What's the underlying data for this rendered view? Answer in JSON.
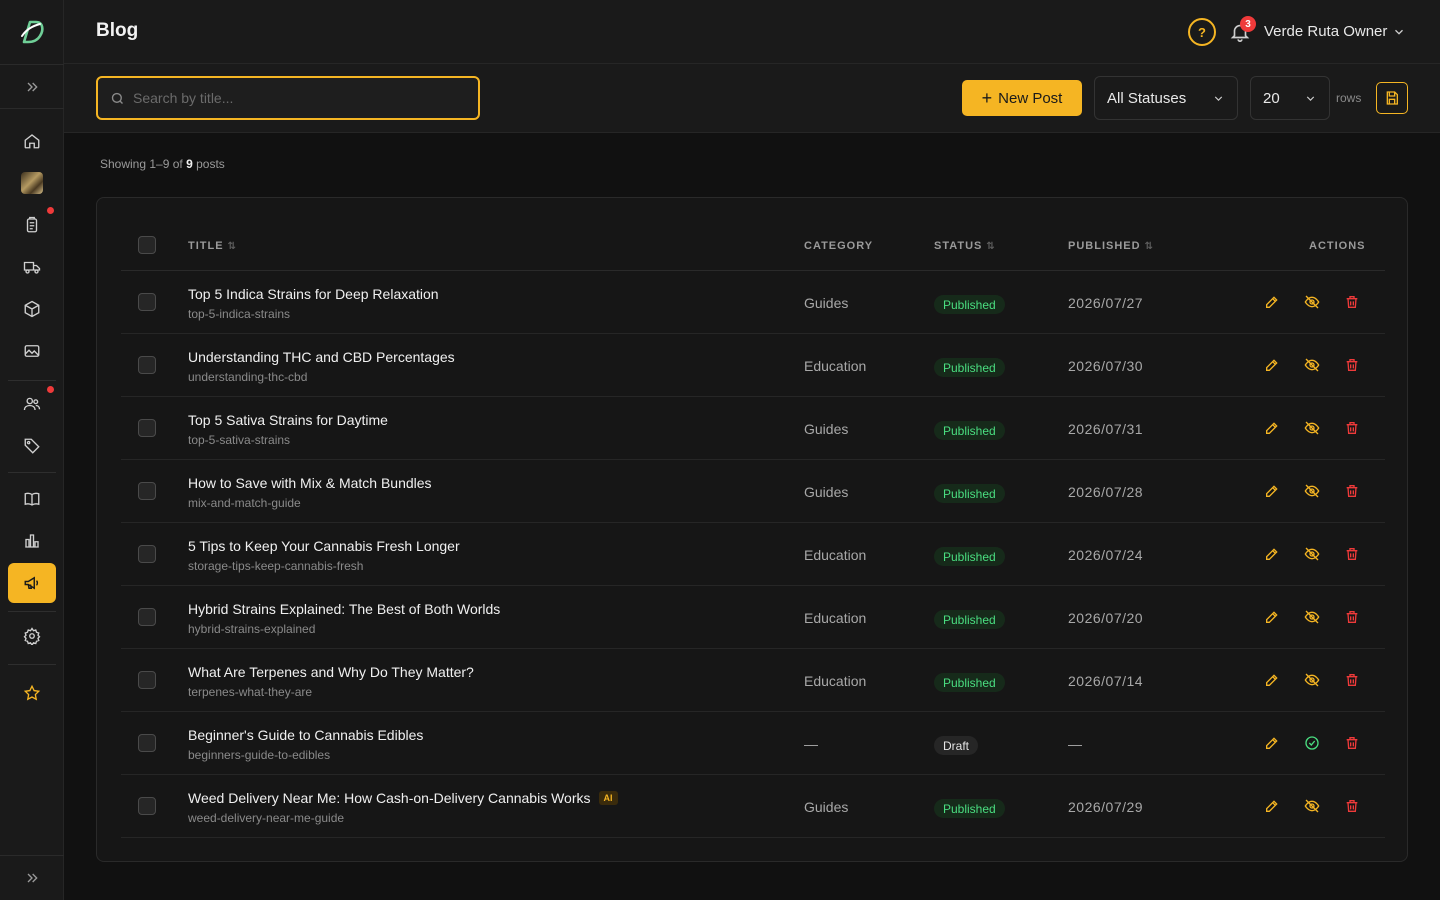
{
  "header": {
    "title": "Blog",
    "help": "?",
    "notifications": "3",
    "user": "Verde Ruta Owner"
  },
  "toolbar": {
    "search_placeholder": "Search by title...",
    "new_post": "New Post",
    "status_filter": "All Statuses",
    "page_size": "20",
    "rows_label": "rows"
  },
  "summary": {
    "prefix": "Showing 1–9 of",
    "count": "9",
    "suffix": "posts"
  },
  "table": {
    "headers": {
      "title": "TITLE",
      "category": "CATEGORY",
      "status": "STATUS",
      "published": "PUBLISHED",
      "actions": "ACTIONS"
    },
    "rows": [
      {
        "title": "Top 5 Indica Strains for Deep Relaxation",
        "slug": "top-5-indica-strains",
        "category": "Guides",
        "status": "Published",
        "date": "2026/07/27"
      },
      {
        "title": "Understanding THC and CBD Percentages",
        "slug": "understanding-thc-cbd",
        "category": "Education",
        "status": "Published",
        "date": "2026/07/30"
      },
      {
        "title": "Top 5 Sativa Strains for Daytime",
        "slug": "top-5-sativa-strains",
        "category": "Guides",
        "status": "Published",
        "date": "2026/07/31"
      },
      {
        "title": "How to Save with Mix & Match Bundles",
        "slug": "mix-and-match-guide",
        "category": "Guides",
        "status": "Published",
        "date": "2026/07/28"
      },
      {
        "title": "5 Tips to Keep Your Cannabis Fresh Longer",
        "slug": "storage-tips-keep-cannabis-fresh",
        "category": "Education",
        "status": "Published",
        "date": "2026/07/24"
      },
      {
        "title": "Hybrid Strains Explained: The Best of Both Worlds",
        "slug": "hybrid-strains-explained",
        "category": "Education",
        "status": "Published",
        "date": "2026/07/20"
      },
      {
        "title": "What Are Terpenes and Why Do They Matter?",
        "slug": "terpenes-what-they-are",
        "category": "Education",
        "status": "Published",
        "date": "2026/07/14"
      },
      {
        "title": "Beginner's Guide to Cannabis Edibles",
        "slug": "beginners-guide-to-edibles",
        "category": "—",
        "status": "Draft",
        "date": "—"
      },
      {
        "title": "Weed Delivery Near Me: How Cash-on-Delivery Cannabis Works",
        "slug": "weed-delivery-near-me-guide",
        "category": "Guides",
        "status": "Published",
        "date": "2026/07/29",
        "badge": "AI"
      }
    ]
  },
  "colors": {
    "accent": "#f5b523",
    "danger": "#ef3a3a",
    "success": "#4ade80",
    "background": "#111111"
  },
  "icons": {
    "sidebar": [
      "home-icon",
      "avatar",
      "clipboard-icon",
      "truck-icon",
      "box-icon",
      "image-icon",
      "users-icon",
      "tag-icon",
      "map-icon",
      "chart-icon",
      "megaphone-icon",
      "gear-icon",
      "star-icon"
    ],
    "row_actions": [
      "edit-icon",
      "hide-icon",
      "trash-icon"
    ]
  }
}
